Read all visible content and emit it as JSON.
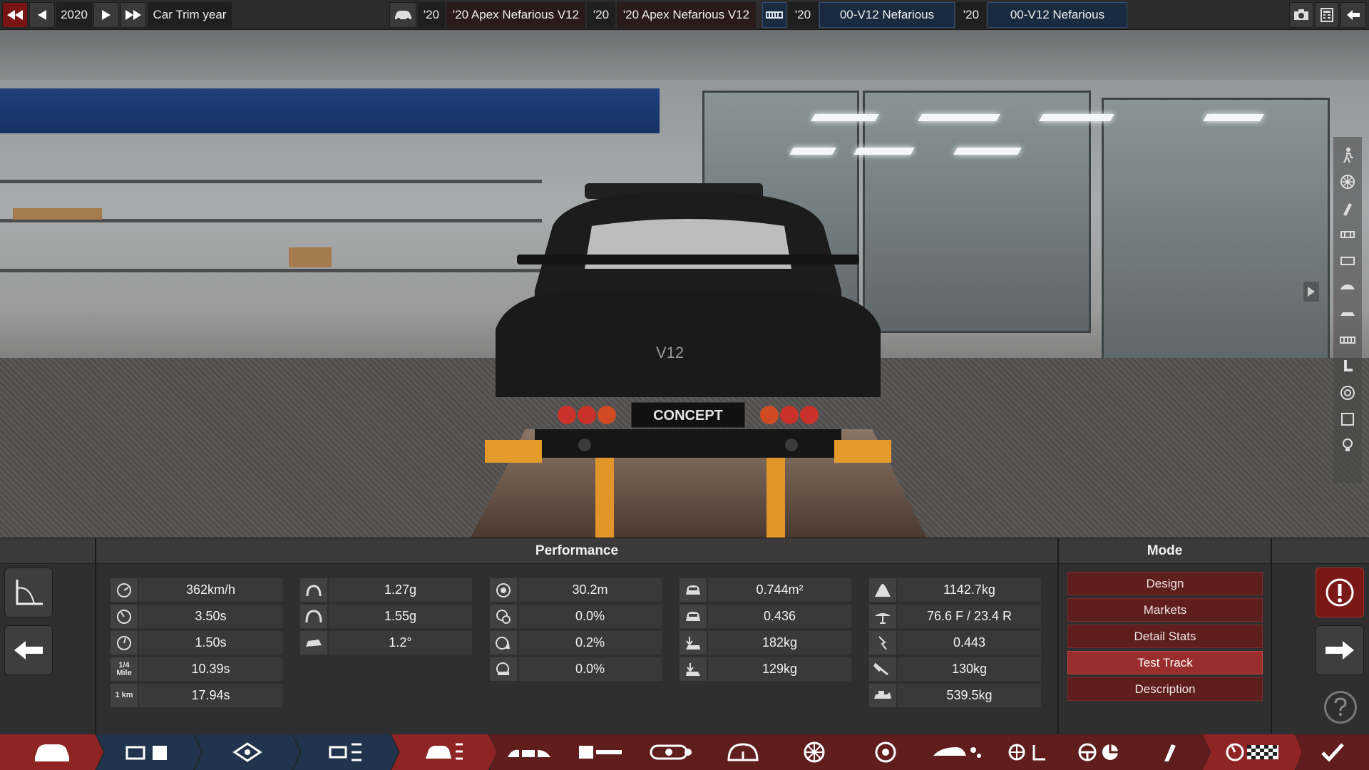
{
  "topbar": {
    "year": "2020",
    "year_label": "Car Trim year",
    "model_year_short": "'20",
    "model_name": "'20 Apex Nefarious V12",
    "trim_year_short": "'20",
    "trim_name": "'20 Apex Nefarious V12",
    "engine_year_short": "'20",
    "engine_name": "00-V12 Nefarious",
    "variant_year_short": "'20",
    "variant_name": "00-V12 Nefarious"
  },
  "scene": {
    "plate_text": "CONCEPT",
    "badge_text": "V12"
  },
  "performance": {
    "title": "Performance",
    "col1": [
      {
        "icon": "top-speed-icon",
        "icon_text": "",
        "value": "362km/h"
      },
      {
        "icon": "accel-0-100-icon",
        "icon_text": "",
        "value": "3.50s"
      },
      {
        "icon": "accel-80-120-icon",
        "icon_text": "",
        "value": "1.50s"
      },
      {
        "icon": "quarter-mile-icon",
        "icon_text": "1/4 Mile",
        "value": "10.39s"
      },
      {
        "icon": "one-km-icon",
        "icon_text": "1 km",
        "value": "17.94s"
      }
    ],
    "col2": [
      {
        "icon": "cornering-icon",
        "value": "1.27g"
      },
      {
        "icon": "max-cornering-icon",
        "value": "1.55g"
      },
      {
        "icon": "body-roll-icon",
        "value": "1.2°"
      }
    ],
    "col3": [
      {
        "icon": "braking-distance-icon",
        "value": "30.2m"
      },
      {
        "icon": "brake-fade-icon",
        "value": "0.0%"
      },
      {
        "icon": "brake-fade-hot-icon",
        "value": "0.2%"
      },
      {
        "icon": "brake-lockup-icon",
        "value": "0.0%"
      }
    ],
    "col4": [
      {
        "icon": "frontal-area-icon",
        "value": "0.744m²"
      },
      {
        "icon": "drag-coefficient-icon",
        "value": "0.436"
      },
      {
        "icon": "front-downforce-icon",
        "value": "182kg"
      },
      {
        "icon": "rear-downforce-icon",
        "value": "129kg"
      }
    ],
    "col5": [
      {
        "icon": "weight-icon",
        "value": "1142.7kg"
      },
      {
        "icon": "weight-distribution-icon",
        "value": "76.6 F / 23.4 R"
      },
      {
        "icon": "lift-coefficient-icon",
        "value": "0.443"
      },
      {
        "icon": "tow-capacity-icon",
        "value": "130kg"
      },
      {
        "icon": "cargo-capacity-icon",
        "value": "539.5kg"
      }
    ]
  },
  "mode": {
    "title": "Mode",
    "buttons": [
      "Design",
      "Markets",
      "Detail Stats",
      "Test Track",
      "Description"
    ],
    "active_index": 3
  },
  "colors": {
    "accent_red": "#8e2424",
    "active_mode": "#9a2e2e",
    "navy_tab": "#22344d"
  },
  "bottom_tabs": [
    "car-body-tab-icon",
    "engine-family-tab-icon",
    "engine-tune-tab-icon",
    "engine-parts-tab-icon",
    "car-trim-tab-icon",
    "chassis-tab-icon",
    "suspension-tab-icon",
    "drivetrain-tab-icon",
    "brakes-tab-icon",
    "wheels-tab-icon",
    "aero-tab-icon",
    "interior-tab-icon",
    "safety-tab-icon",
    "steering-tab-icon",
    "fixtures-tab-icon",
    "testing-tab-icon",
    "finish-check-icon"
  ]
}
